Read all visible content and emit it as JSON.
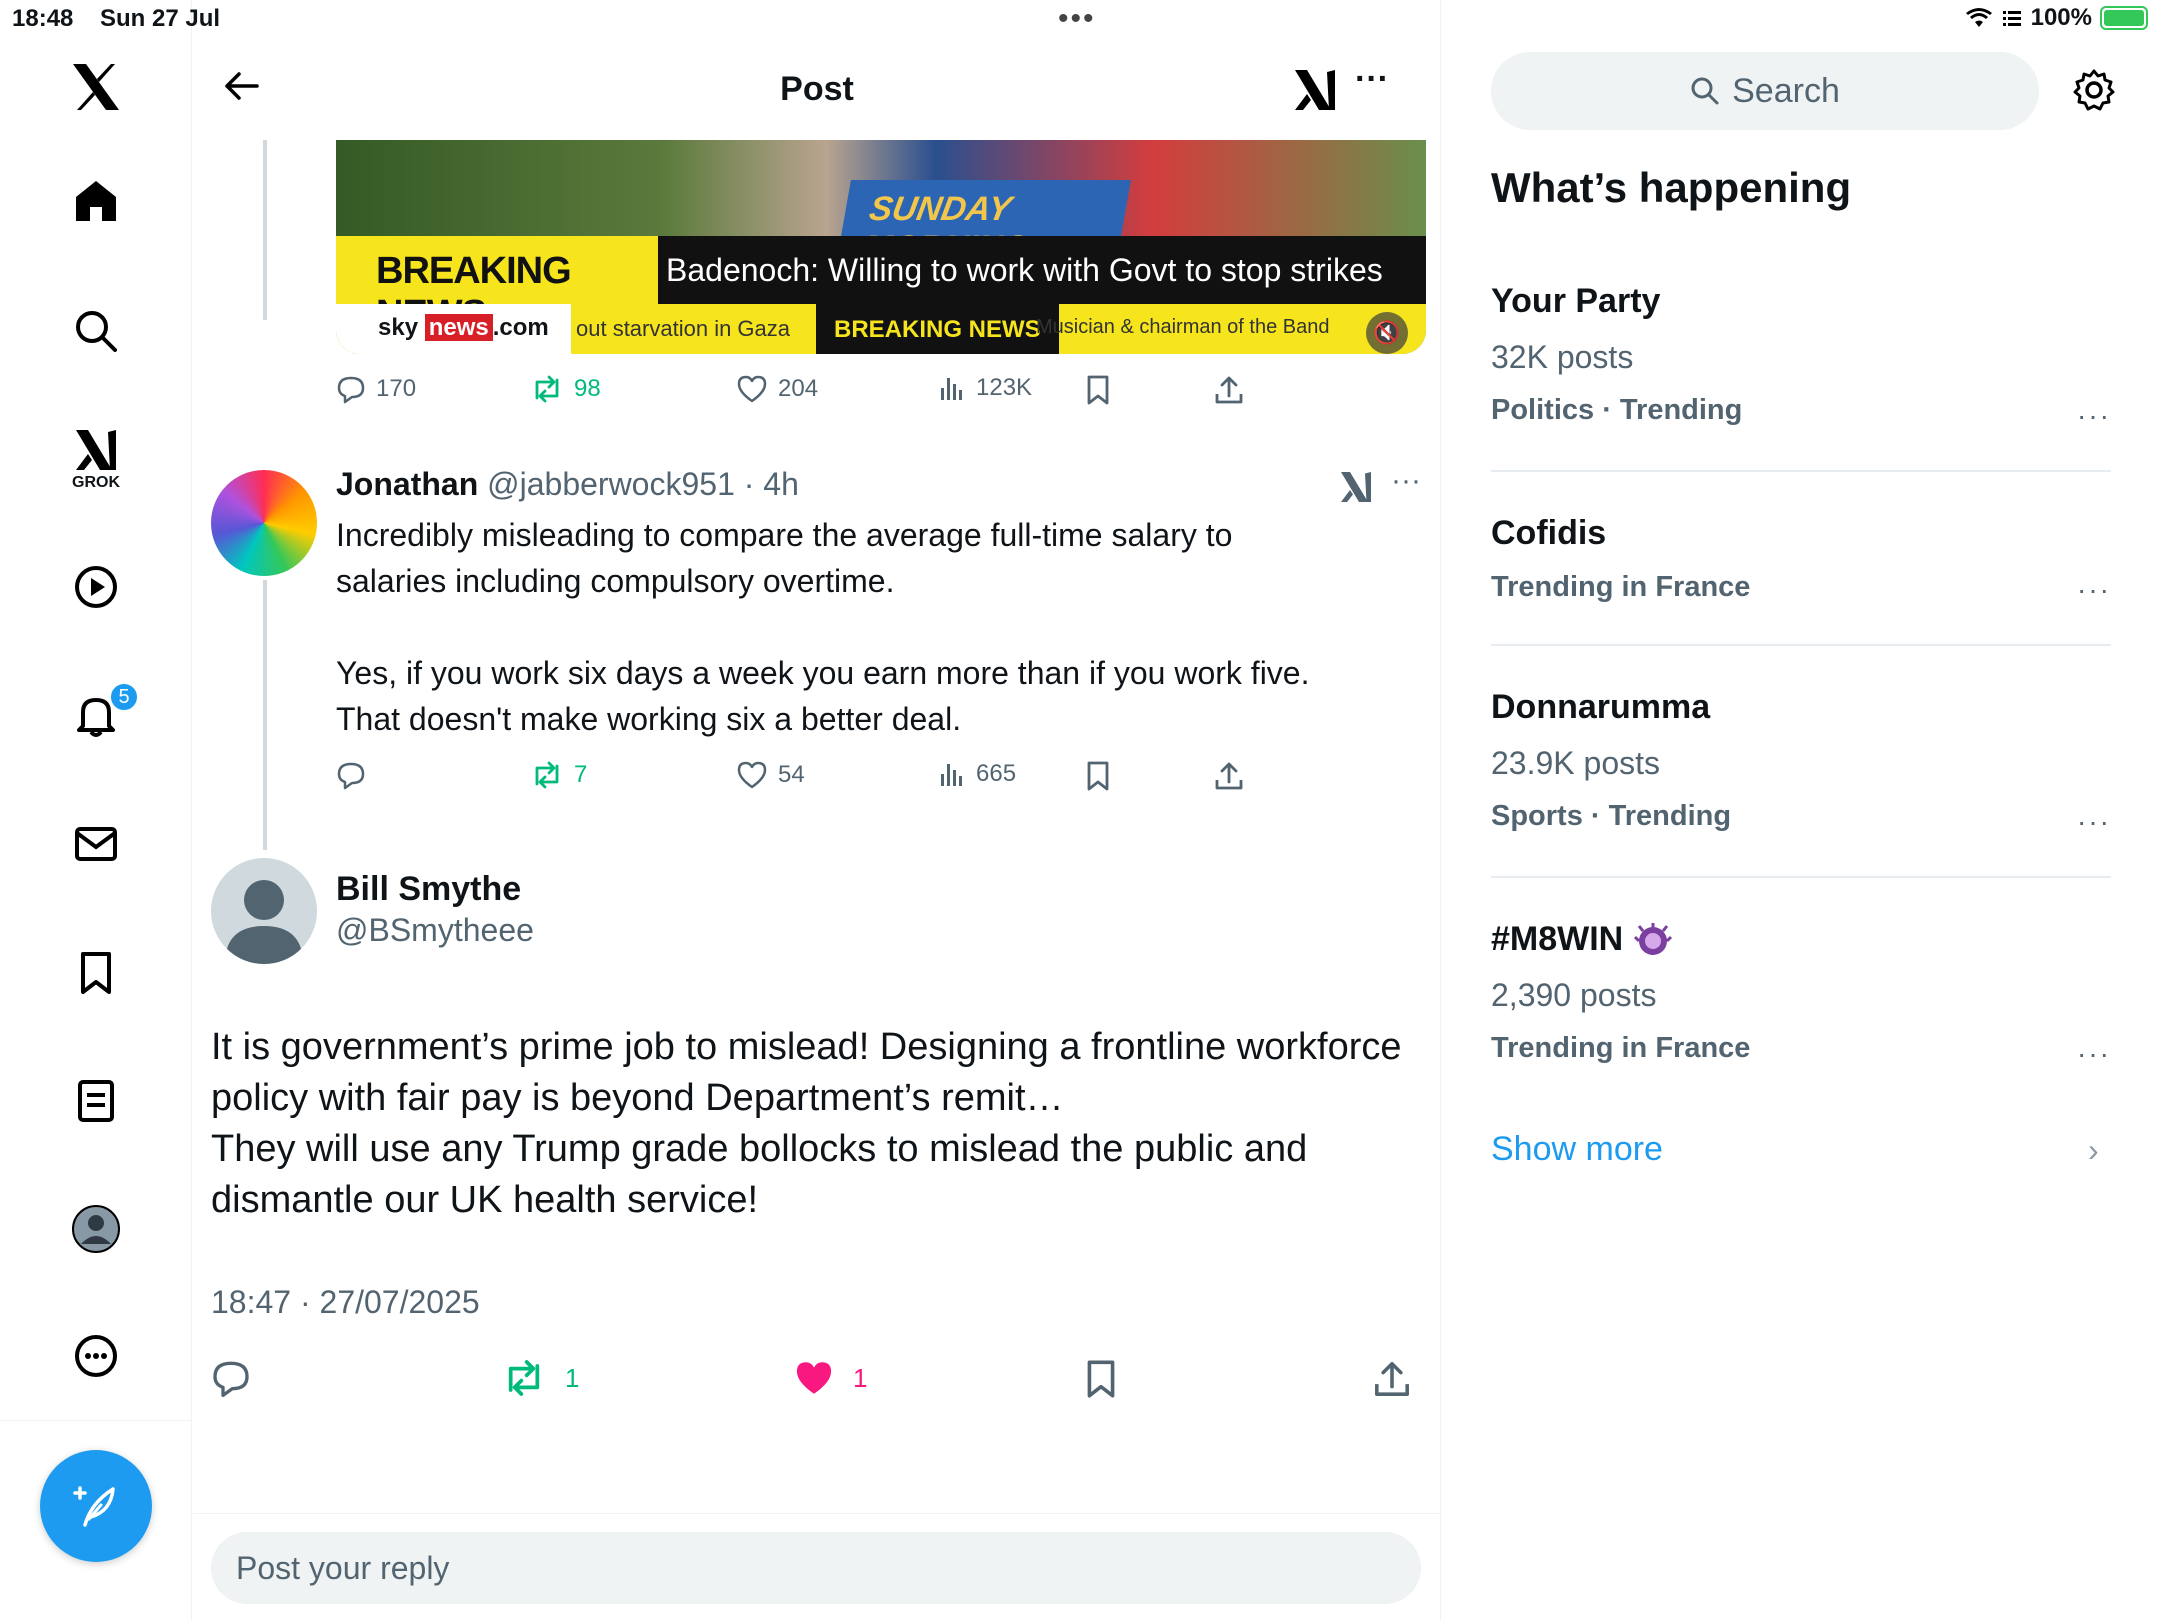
{
  "status_bar": {
    "time": "18:48",
    "date": "Sun 27 Jul",
    "battery": "100%"
  },
  "left_nav": {
    "grok_label": "GROK",
    "notification_count": "5"
  },
  "header": {
    "title": "Post"
  },
  "video": {
    "podium_text": "SUNDAY MORNING",
    "breaking_label": "BREAKING NEWS",
    "headline": "Badenoch: Willing to work with Govt to stop strikes",
    "sky_prefix": "sky",
    "sky_news": "news",
    "sky_suffix": ".com",
    "ticker_a": "out starvation in Gaza",
    "ticker_b": "BREAKING NEWS",
    "ticker_c": "Musician & chairman of the Band",
    "mute_icon": "🔇"
  },
  "video_actions": {
    "replies": "170",
    "reposts": "98",
    "likes": "204",
    "views": "123K"
  },
  "reply": {
    "name": "Jonathan",
    "handle": "@jabberwock951",
    "time": "4h",
    "body_line1": "Incredibly misleading to compare the average full-time salary to",
    "body_line2": "salaries including compulsory overtime.",
    "body_line3": "Yes, if you work six days a week you earn more than if you work five.",
    "body_line4": "That doesn't make working six a better deal.",
    "replies": "",
    "reposts": "7",
    "likes": "54",
    "views": "665"
  },
  "main_post": {
    "name": "Bill Smythe",
    "handle": "@BSmytheee",
    "body_line1": "It is government’s prime job to mislead! Designing a frontline workforce",
    "body_line2": "policy with fair pay is beyond Department’s remit…",
    "body_line3": "They will use any Trump grade bollocks to mislead the public and",
    "body_line4": "dismantle our UK health service!",
    "timestamp": "18:47 · 27/07/2025",
    "reposts": "1",
    "likes": "1",
    "like_color": "#f91880",
    "repost_color": "#00ba7c"
  },
  "reply_box": {
    "placeholder": "Post your reply"
  },
  "sidebar": {
    "search_placeholder": "Search",
    "heading": "What’s happening",
    "trends": [
      {
        "name": "Your Party",
        "posts": "32K posts",
        "meta": "Politics · Trending"
      },
      {
        "name": "Cofidis",
        "posts": "",
        "meta": "Trending in France"
      },
      {
        "name": "Donnarumma",
        "posts": "23.9K posts",
        "meta": "Sports · Trending"
      },
      {
        "name": "#M8WIN",
        "posts": "2,390 posts",
        "meta": "Trending in France"
      }
    ],
    "show_more": "Show more"
  },
  "colors": {
    "accent": "#1d9bf0",
    "text_secondary": "#536471",
    "green": "#00ba7c",
    "pink": "#f91880"
  }
}
